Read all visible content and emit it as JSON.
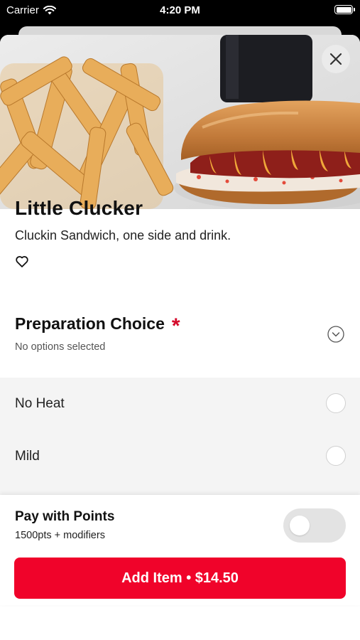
{
  "status_bar": {
    "carrier": "Carrier",
    "time": "4:20 PM"
  },
  "hero": {
    "image": "fries-and-chicken-sandwich",
    "close_icon": "close-icon"
  },
  "item": {
    "title": "Little Clucker",
    "description": "Cluckin Sandwich, one side and drink.",
    "favorite_icon": "heart-icon"
  },
  "preparation": {
    "title": "Preparation Choice",
    "required_mark": "*",
    "status": "No options selected",
    "options": [
      {
        "label": "No Heat",
        "selected": false
      },
      {
        "label": "Mild",
        "selected": false
      }
    ]
  },
  "footer": {
    "points_title": "Pay with Points",
    "points_sub": "1500pts + modifiers",
    "points_toggle_on": false,
    "add_button": "Add Item • $14.50"
  },
  "colors": {
    "accent": "#f0032a",
    "required": "#d40a2b",
    "options_bg": "#f4f4f4"
  }
}
